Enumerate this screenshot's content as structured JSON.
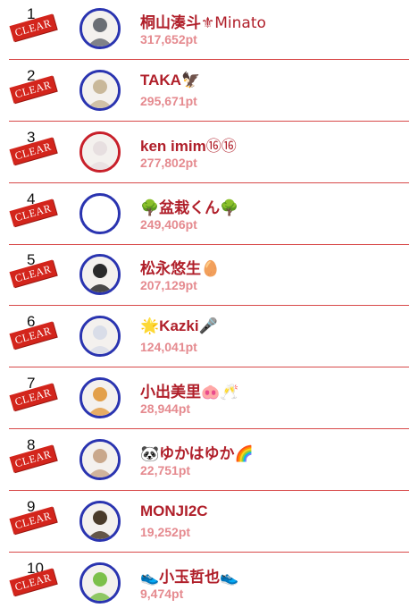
{
  "ranking": [
    {
      "rank": "1",
      "badge": "CLEAR",
      "name": "桐山湊斗",
      "name_suffix": "⚜Minato",
      "name_prefix": "",
      "points": "317,652pt",
      "avatar_color": "#6b6f75",
      "ring": "blue"
    },
    {
      "rank": "2",
      "badge": "CLEAR",
      "name": "TAKA",
      "name_suffix": "🦅",
      "name_prefix": "",
      "points": "295,671pt",
      "avatar_color": "#c9b89a",
      "ring": "blue"
    },
    {
      "rank": "3",
      "badge": "CLEAR",
      "name": "ken imim",
      "name_suffix": "⑯⑯",
      "name_prefix": "",
      "points": "277,802pt",
      "avatar_color": "#e7dfe0",
      "ring": "red"
    },
    {
      "rank": "4",
      "badge": "CLEAR",
      "name": "盆栽くん",
      "name_suffix": "🌳",
      "name_prefix": "🌳",
      "points": "249,406pt",
      "avatar_color": "#ffffff",
      "ring": "blue"
    },
    {
      "rank": "5",
      "badge": "CLEAR",
      "name": "松永悠生",
      "name_suffix": "🥚",
      "name_prefix": "",
      "points": "207,129pt",
      "avatar_color": "#2b2b2b",
      "ring": "blue"
    },
    {
      "rank": "6",
      "badge": "CLEAR",
      "name": "Kazki",
      "name_suffix": "🎤",
      "name_prefix": "🌟",
      "points": "124,041pt",
      "avatar_color": "#d9dde8",
      "ring": "blue"
    },
    {
      "rank": "7",
      "badge": "CLEAR",
      "name": "小出美里",
      "name_suffix": "🐽🥂",
      "name_prefix": "",
      "points": "28,944pt",
      "avatar_color": "#e3a04a",
      "ring": "blue"
    },
    {
      "rank": "8",
      "badge": "CLEAR",
      "name": "ゆかはゆか",
      "name_suffix": "🌈",
      "name_prefix": "🐼",
      "points": "22,751pt",
      "avatar_color": "#c9a88c",
      "ring": "blue"
    },
    {
      "rank": "9",
      "badge": "CLEAR",
      "name": "MONJI2C",
      "name_suffix": "",
      "name_prefix": "",
      "points": "19,252pt",
      "avatar_color": "#4a3b2a",
      "ring": "blue"
    },
    {
      "rank": "10",
      "badge": "CLEAR",
      "name": "小玉哲也",
      "name_suffix": "👟",
      "name_prefix": "👟",
      "points": "9,474pt",
      "avatar_color": "#7cc04a",
      "ring": "blue"
    }
  ]
}
